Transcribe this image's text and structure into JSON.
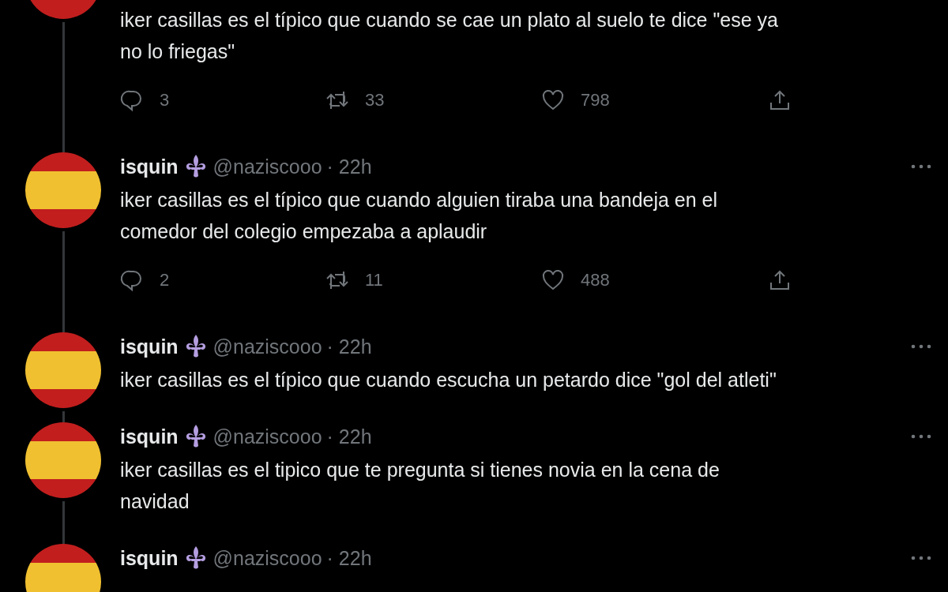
{
  "tweets": [
    {
      "text": "iker casillas es el típico que cuando se cae un plato al suelo te dice \"ese ya\nno lo friegas\"",
      "actions": {
        "replies": "3",
        "retweets": "33",
        "likes": "798"
      }
    },
    {
      "name": "isquin",
      "handle": "@naziscooo",
      "time": "· 22h",
      "text": "iker casillas es el típico que cuando alguien tiraba una bandeja en el\ncomedor del colegio empezaba a aplaudir",
      "actions": {
        "replies": "2",
        "retweets": "11",
        "likes": "488"
      }
    },
    {
      "name": "isquin",
      "handle": "@naziscooo",
      "time": "· 22h",
      "text": "iker casillas es el típico que cuando escucha un petardo dice \"gol del atleti\""
    },
    {
      "name": "isquin",
      "handle": "@naziscooo",
      "time": "· 22h",
      "text": "iker casillas es el tipico que te pregunta si tienes novia en la cena de\nnavidad"
    },
    {
      "name": "isquin",
      "handle": "@naziscooo",
      "time": "· 22h"
    }
  ]
}
